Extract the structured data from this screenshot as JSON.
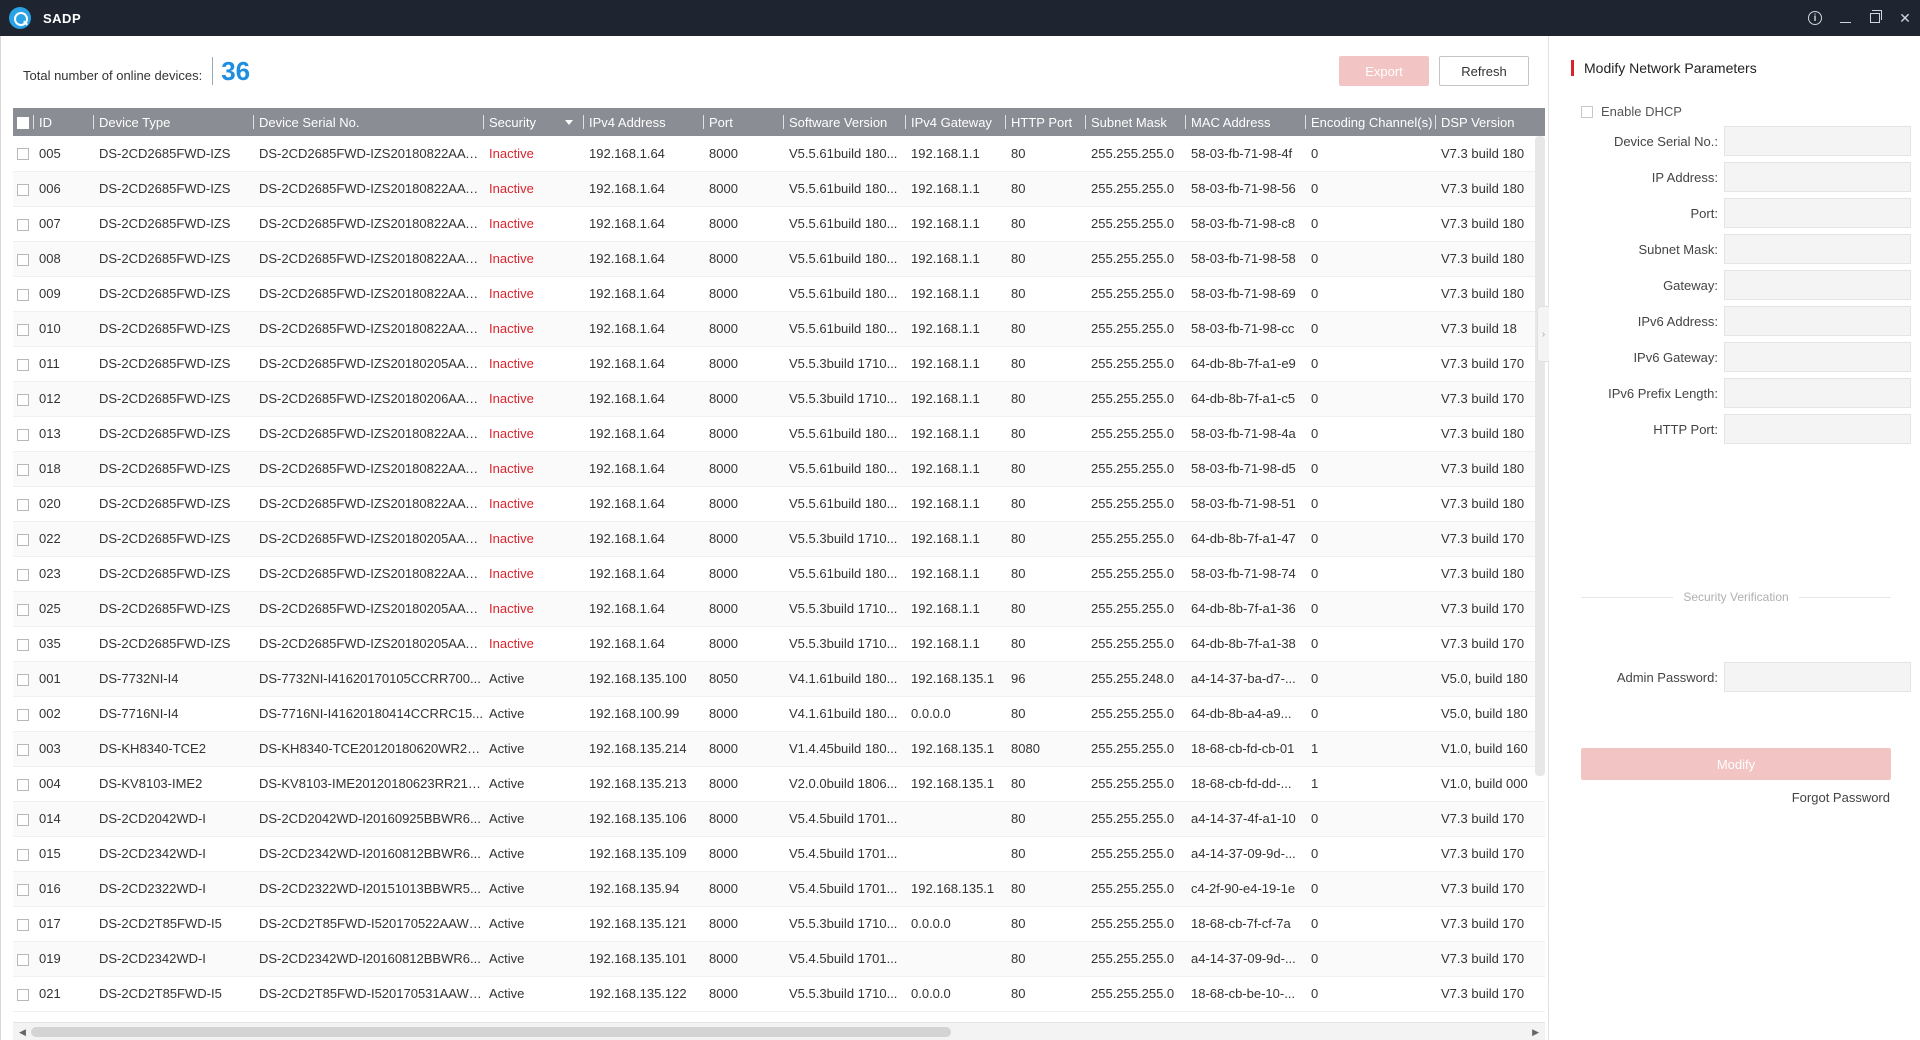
{
  "app": {
    "title": "SADP"
  },
  "summary": {
    "label": "Total number of online devices:",
    "count": "36"
  },
  "toolbar": {
    "export_label": "Export",
    "refresh_label": "Refresh"
  },
  "table": {
    "columns": [
      "ID",
      "Device Type",
      "Device Serial No.",
      "Security",
      "IPv4 Address",
      "Port",
      "Software Version",
      "IPv4 Gateway",
      "HTTP Port",
      "Subnet Mask",
      "MAC Address",
      "Encoding Channel(s)",
      "DSP Version"
    ],
    "rows": [
      [
        "005",
        "DS-2CD2685FWD-IZS",
        "DS-2CD2685FWD-IZS20180822AAW...",
        "Inactive",
        "192.168.1.64",
        "8000",
        "V5.5.61build 180...",
        "192.168.1.1",
        "80",
        "255.255.255.0",
        "58-03-fb-71-98-4f",
        "0",
        "V7.3 build 180"
      ],
      [
        "006",
        "DS-2CD2685FWD-IZS",
        "DS-2CD2685FWD-IZS20180822AAW...",
        "Inactive",
        "192.168.1.64",
        "8000",
        "V5.5.61build 180...",
        "192.168.1.1",
        "80",
        "255.255.255.0",
        "58-03-fb-71-98-56",
        "0",
        "V7.3 build 180"
      ],
      [
        "007",
        "DS-2CD2685FWD-IZS",
        "DS-2CD2685FWD-IZS20180822AAW...",
        "Inactive",
        "192.168.1.64",
        "8000",
        "V5.5.61build 180...",
        "192.168.1.1",
        "80",
        "255.255.255.0",
        "58-03-fb-71-98-c8",
        "0",
        "V7.3 build 180"
      ],
      [
        "008",
        "DS-2CD2685FWD-IZS",
        "DS-2CD2685FWD-IZS20180822AAW...",
        "Inactive",
        "192.168.1.64",
        "8000",
        "V5.5.61build 180...",
        "192.168.1.1",
        "80",
        "255.255.255.0",
        "58-03-fb-71-98-58",
        "0",
        "V7.3 build 180"
      ],
      [
        "009",
        "DS-2CD2685FWD-IZS",
        "DS-2CD2685FWD-IZS20180822AAW...",
        "Inactive",
        "192.168.1.64",
        "8000",
        "V5.5.61build 180...",
        "192.168.1.1",
        "80",
        "255.255.255.0",
        "58-03-fb-71-98-69",
        "0",
        "V7.3 build 180"
      ],
      [
        "010",
        "DS-2CD2685FWD-IZS",
        "DS-2CD2685FWD-IZS20180822AAW...",
        "Inactive",
        "192.168.1.64",
        "8000",
        "V5.5.61build 180...",
        "192.168.1.1",
        "80",
        "255.255.255.0",
        "58-03-fb-71-98-cc",
        "0",
        "V7.3 build 18"
      ],
      [
        "011",
        "DS-2CD2685FWD-IZS",
        "DS-2CD2685FWD-IZS20180205AAW...",
        "Inactive",
        "192.168.1.64",
        "8000",
        "V5.5.3build 1710...",
        "192.168.1.1",
        "80",
        "255.255.255.0",
        "64-db-8b-7f-a1-e9",
        "0",
        "V7.3 build 170"
      ],
      [
        "012",
        "DS-2CD2685FWD-IZS",
        "DS-2CD2685FWD-IZS20180206AAW...",
        "Inactive",
        "192.168.1.64",
        "8000",
        "V5.5.3build 1710...",
        "192.168.1.1",
        "80",
        "255.255.255.0",
        "64-db-8b-7f-a1-c5",
        "0",
        "V7.3 build 170"
      ],
      [
        "013",
        "DS-2CD2685FWD-IZS",
        "DS-2CD2685FWD-IZS20180822AAW...",
        "Inactive",
        "192.168.1.64",
        "8000",
        "V5.5.61build 180...",
        "192.168.1.1",
        "80",
        "255.255.255.0",
        "58-03-fb-71-98-4a",
        "0",
        "V7.3 build 180"
      ],
      [
        "018",
        "DS-2CD2685FWD-IZS",
        "DS-2CD2685FWD-IZS20180822AAW...",
        "Inactive",
        "192.168.1.64",
        "8000",
        "V5.5.61build 180...",
        "192.168.1.1",
        "80",
        "255.255.255.0",
        "58-03-fb-71-98-d5",
        "0",
        "V7.3 build 180"
      ],
      [
        "020",
        "DS-2CD2685FWD-IZS",
        "DS-2CD2685FWD-IZS20180822AAW...",
        "Inactive",
        "192.168.1.64",
        "8000",
        "V5.5.61build 180...",
        "192.168.1.1",
        "80",
        "255.255.255.0",
        "58-03-fb-71-98-51",
        "0",
        "V7.3 build 180"
      ],
      [
        "022",
        "DS-2CD2685FWD-IZS",
        "DS-2CD2685FWD-IZS20180205AAW...",
        "Inactive",
        "192.168.1.64",
        "8000",
        "V5.5.3build 1710...",
        "192.168.1.1",
        "80",
        "255.255.255.0",
        "64-db-8b-7f-a1-47",
        "0",
        "V7.3 build 170"
      ],
      [
        "023",
        "DS-2CD2685FWD-IZS",
        "DS-2CD2685FWD-IZS20180822AAW...",
        "Inactive",
        "192.168.1.64",
        "8000",
        "V5.5.61build 180...",
        "192.168.1.1",
        "80",
        "255.255.255.0",
        "58-03-fb-71-98-74",
        "0",
        "V7.3 build 180"
      ],
      [
        "025",
        "DS-2CD2685FWD-IZS",
        "DS-2CD2685FWD-IZS20180205AAW...",
        "Inactive",
        "192.168.1.64",
        "8000",
        "V5.5.3build 1710...",
        "192.168.1.1",
        "80",
        "255.255.255.0",
        "64-db-8b-7f-a1-36",
        "0",
        "V7.3 build 170"
      ],
      [
        "035",
        "DS-2CD2685FWD-IZS",
        "DS-2CD2685FWD-IZS20180205AAW...",
        "Inactive",
        "192.168.1.64",
        "8000",
        "V5.5.3build 1710...",
        "192.168.1.1",
        "80",
        "255.255.255.0",
        "64-db-8b-7f-a1-38",
        "0",
        "V7.3 build 170"
      ],
      [
        "001",
        "DS-7732NI-I4",
        "DS-7732NI-I41620170105CCRR700...",
        "Active",
        "192.168.135.100",
        "8050",
        "V4.1.61build 180...",
        "192.168.135.1",
        "96",
        "255.255.248.0",
        "a4-14-37-ba-d7-...",
        "0",
        "V5.0, build 180"
      ],
      [
        "002",
        "DS-7716NI-I4",
        "DS-7716NI-I41620180414CCRRC15...",
        "Active",
        "192.168.100.99",
        "8000",
        "V4.1.61build 180...",
        "0.0.0.0",
        "80",
        "255.255.255.0",
        "64-db-8b-a4-a9...",
        "0",
        "V5.0, build 180"
      ],
      [
        "003",
        "DS-KH8340-TCE2",
        "DS-KH8340-TCE20120180620WR21...",
        "Active",
        "192.168.135.214",
        "8000",
        "V1.4.45build 180...",
        "192.168.135.1",
        "8080",
        "255.255.255.0",
        "18-68-cb-fd-cb-01",
        "1",
        "V1.0, build 160"
      ],
      [
        "004",
        "DS-KV8103-IME2",
        "DS-KV8103-IME20120180623RR217...",
        "Active",
        "192.168.135.213",
        "8000",
        "V2.0.0build 1806...",
        "192.168.135.1",
        "80",
        "255.255.255.0",
        "18-68-cb-fd-dd-...",
        "1",
        "V1.0, build 000"
      ],
      [
        "014",
        "DS-2CD2042WD-I",
        "DS-2CD2042WD-I20160925BBWR6...",
        "Active",
        "192.168.135.106",
        "8000",
        "V5.4.5build 1701...",
        "",
        "80",
        "255.255.255.0",
        "a4-14-37-4f-a1-10",
        "0",
        "V7.3 build 170"
      ],
      [
        "015",
        "DS-2CD2342WD-I",
        "DS-2CD2342WD-I20160812BBWR6...",
        "Active",
        "192.168.135.109",
        "8000",
        "V5.4.5build 1701...",
        "",
        "80",
        "255.255.255.0",
        "a4-14-37-09-9d-...",
        "0",
        "V7.3 build 170"
      ],
      [
        "016",
        "DS-2CD2322WD-I",
        "DS-2CD2322WD-I20151013BBWR5...",
        "Active",
        "192.168.135.94",
        "8000",
        "V5.4.5build 1701...",
        "192.168.135.1",
        "80",
        "255.255.255.0",
        "c4-2f-90-e4-19-1e",
        "0",
        "V7.3 build 170"
      ],
      [
        "017",
        "DS-2CD2T85FWD-I5",
        "DS-2CD2T85FWD-I520170522AAWR...",
        "Active",
        "192.168.135.121",
        "8000",
        "V5.5.3build 1710...",
        "0.0.0.0",
        "80",
        "255.255.255.0",
        "18-68-cb-7f-cf-7a",
        "0",
        "V7.3 build 170"
      ],
      [
        "019",
        "DS-2CD2342WD-I",
        "DS-2CD2342WD-I20160812BBWR6...",
        "Active",
        "192.168.135.101",
        "8000",
        "V5.4.5build 1701...",
        "",
        "80",
        "255.255.255.0",
        "a4-14-37-09-9d-...",
        "0",
        "V7.3 build 170"
      ],
      [
        "021",
        "DS-2CD2T85FWD-I5",
        "DS-2CD2T85FWD-I520170531AAWR...",
        "Active",
        "192.168.135.122",
        "8000",
        "V5.5.3build 1710...",
        "0.0.0.0",
        "80",
        "255.255.255.0",
        "18-68-cb-be-10-...",
        "0",
        "V7.3 build 170"
      ]
    ]
  },
  "panel": {
    "title": "Modify Network Parameters",
    "dhcp_label": "Enable DHCP",
    "fields": [
      {
        "label": "Device Serial No.:",
        "value": ""
      },
      {
        "label": "IP Address:",
        "value": ""
      },
      {
        "label": "Port:",
        "value": ""
      },
      {
        "label": "Subnet Mask:",
        "value": ""
      },
      {
        "label": "Gateway:",
        "value": ""
      },
      {
        "label": "IPv6 Address:",
        "value": ""
      },
      {
        "label": "IPv6 Gateway:",
        "value": ""
      },
      {
        "label": "IPv6 Prefix Length:",
        "value": ""
      },
      {
        "label": "HTTP Port:",
        "value": ""
      }
    ],
    "security_label": "Security Verification",
    "admin_password_label": "Admin Password:",
    "modify_label": "Modify",
    "forgot_label": "Forgot Password"
  },
  "colors": {
    "accent_red": "#d9242d",
    "accent_blue": "#1f8ee0",
    "header_gray": "#8a8d93",
    "disabled_pink": "#f3c4c4"
  }
}
